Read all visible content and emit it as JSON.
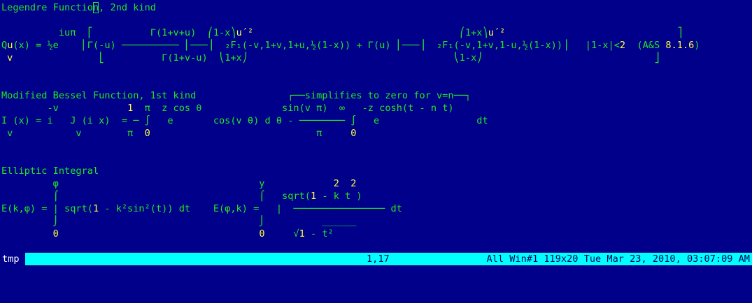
{
  "editor": {
    "lines": [
      [
        {
          "t": "Legendre Functio"
        },
        {
          "t": "n",
          "c": "cursor"
        },
        {
          "t": ", 2nd kind"
        }
      ],
      [
        {
          "t": ""
        }
      ],
      [
        {
          "t": "          iuπ  ⎡          Γ(1+v+u)  ⎛1-x⎞"
        },
        {
          "t": "u´²",
          "c": "num"
        },
        {
          "t": "                                    ⎛1+x⎞"
        },
        {
          "t": "u´²",
          "c": "num"
        },
        {
          "t": "                              ⎤"
        }
      ],
      [
        {
          "t": "Q"
        },
        {
          "t": "u",
          "c": "num"
        },
        {
          "t": "(x) = ½e    ⎢Γ(-u) ────────── ⎜───⎟  ₂F₁(-v,1+v,1+u,½(1-x)) + Γ(u) ⎜───⎟  ₂F₁(-v,1+v,1-u,½(1-x))⎥   |1-x|<"
        },
        {
          "t": "2",
          "c": "num"
        },
        {
          "t": "  (A&S "
        },
        {
          "t": "8.1.6",
          "c": "num"
        },
        {
          "t": ")"
        }
      ],
      [
        {
          "t": " v",
          "c": "num"
        },
        {
          "t": "               ⎣          Γ(1+v-u)  ⎝1+x⎠                                    ⎝1-x⎠                              ⎦"
        }
      ],
      [
        {
          "t": ""
        }
      ],
      [
        {
          "t": ""
        }
      ],
      [
        {
          "t": "Modified Bessel Function, 1st kind                ┌──simplifies to zero for v=n──┐"
        }
      ],
      [
        {
          "t": "        -v            "
        },
        {
          "t": "1",
          "c": "num"
        },
        {
          "t": "  π  z cos θ              sin(v π)  ∞   -z cosh(t - n t)"
        }
      ],
      [
        {
          "t": "I (x) = i   J (i x)  = ─ ∫   e       cos(v θ) d θ - ──────── ∫   e                 dt"
        }
      ],
      [
        {
          "t": " v           v        π  "
        },
        {
          "t": "0",
          "c": "num"
        },
        {
          "t": "                             π     "
        },
        {
          "t": "0",
          "c": "num"
        }
      ],
      [
        {
          "t": ""
        }
      ],
      [
        {
          "t": ""
        }
      ],
      [
        {
          "t": "Elliptic Integral"
        }
      ],
      [
        {
          "t": "         φ                                   y            "
        },
        {
          "t": "2  2",
          "c": "num"
        }
      ],
      [
        {
          "t": "         ⌠                                   ⌠   sqrt("
        },
        {
          "t": "1",
          "c": "num"
        },
        {
          "t": " - k t )"
        }
      ],
      [
        {
          "t": "E(k,φ) = | sqrt("
        },
        {
          "t": "1",
          "c": "num"
        },
        {
          "t": " - k²sin²(t)) dt    E(φ,k) =   |  ──────────────── dt"
        }
      ],
      [
        {
          "t": "         ⌡                                   ⌡          ______"
        }
      ],
      [
        {
          "t": "         "
        },
        {
          "t": "0",
          "c": "num"
        },
        {
          "t": "                                   "
        },
        {
          "t": "0",
          "c": "num"
        },
        {
          "t": "     √"
        },
        {
          "t": "1",
          "c": "num"
        },
        {
          "t": " - t²"
        }
      ]
    ]
  },
  "status": {
    "buffer": "tmp",
    "position": "1,17",
    "info": "All Win#1 119x20 Tue Mar 23, 2010, 03:07:09 AM"
  }
}
